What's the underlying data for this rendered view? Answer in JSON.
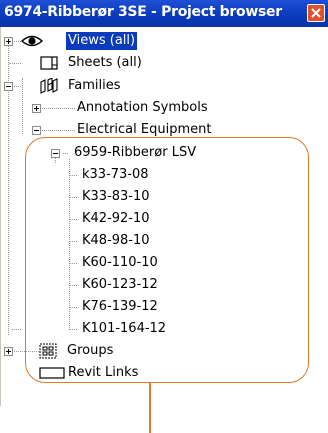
{
  "window": {
    "title": "6974-Ribberør 3SE - Project browser"
  },
  "tree": {
    "views": "Views (all)",
    "sheets": "Sheets (all)",
    "families": "Families",
    "annotation_symbols": "Annotation Symbols",
    "electrical_equipment": "Electrical Equipment",
    "family_name": "6959-Ribberør LSV",
    "types": [
      "k33-73-08",
      "K33-83-10",
      "K42-92-10",
      "K48-98-10",
      "K60-110-10",
      "K60-123-12",
      "K76-139-12",
      "K101-164-12"
    ],
    "groups": "Groups",
    "revit_links": "Revit Links"
  },
  "colors": {
    "titlebar": "#0a3bbd",
    "selection": "#0a3bbd",
    "highlight_frame": "#e07b2a",
    "close_button": "#e0502a"
  },
  "icons": {
    "views": "eye-icon",
    "sheets": "sheet-icon",
    "families": "families-icon",
    "groups": "groups-icon",
    "revit_links": "link-icon",
    "close": "close-icon"
  }
}
